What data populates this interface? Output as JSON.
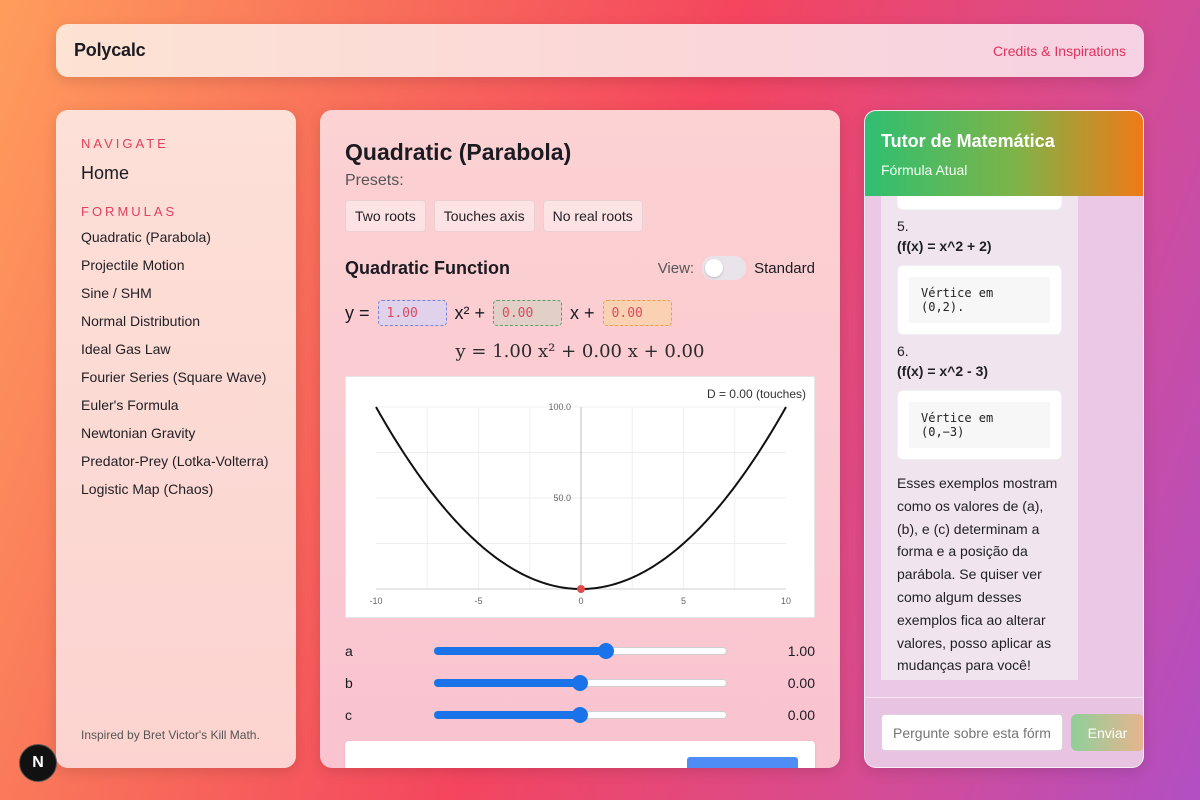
{
  "header": {
    "brand": "Polycalc",
    "credits_link": "Credits & Inspirations"
  },
  "sidebar": {
    "navigate_title": "NAVIGATE",
    "home": "Home",
    "formulas_title": "FORMULAS",
    "items": [
      "Quadratic (Parabola)",
      "Projectile Motion",
      "Sine / SHM",
      "Normal Distribution",
      "Ideal Gas Law",
      "Fourier Series (Square Wave)",
      "Euler's Formula",
      "Newtonian Gravity",
      "Predator-Prey (Lotka-Volterra)",
      "Logistic Map (Chaos)"
    ],
    "footer": "Inspired by Bret Victor's Kill Math."
  },
  "main": {
    "title": "Quadratic (Parabola)",
    "presets_label": "Presets:",
    "presets": [
      "Two roots",
      "Touches axis",
      "No real roots"
    ],
    "function_title": "Quadratic Function",
    "view_label": "View:",
    "view_value": "Standard",
    "eq_prefix": "y =",
    "eq_x2": "x² +",
    "eq_x": "x +",
    "coef_a": "1.00",
    "coef_b": "0.00",
    "coef_c": "0.00",
    "rendered_eq": "y = 1.00 x² + 0.00 x + 0.00",
    "sliders": [
      {
        "label": "a",
        "value": "1.00",
        "fraction": 0.59
      },
      {
        "label": "b",
        "value": "0.00",
        "fraction": 0.5
      },
      {
        "label": "c",
        "value": "0.00",
        "fraction": 0.5
      }
    ],
    "accent_color": "#1a73e8"
  },
  "chart_data": {
    "type": "line",
    "function": "y = 1.00x^2 + 0.00x + 0.00",
    "x": [
      -10,
      -9,
      -8,
      -7,
      -6,
      -5,
      -4,
      -3,
      -2,
      -1,
      0,
      1,
      2,
      3,
      4,
      5,
      6,
      7,
      8,
      9,
      10
    ],
    "y": [
      100,
      81,
      64,
      49,
      36,
      25,
      16,
      9,
      4,
      1,
      0,
      1,
      4,
      9,
      16,
      25,
      36,
      49,
      64,
      81,
      100
    ],
    "xlim": [
      -10,
      10
    ],
    "ylim": [
      0,
      100
    ],
    "x_ticks": [
      "-10",
      "-5",
      "0",
      "5",
      "10"
    ],
    "y_ticks": [
      "50.0",
      "100.0"
    ],
    "vertex": {
      "x": 0,
      "y": 0
    },
    "annotation": "D = 0.00 (touches)",
    "grid": true,
    "line_color": "#111111",
    "vertex_color": "#e24b4b"
  },
  "chat": {
    "title": "Tutor de Matemática",
    "subtitle": "Fórmula Atual",
    "examples": [
      {
        "num": "5.",
        "formula": "(f(x) = x^2 + 2)",
        "code": "Vértice em (0,2)."
      },
      {
        "num": "6.",
        "formula": "(f(x) = x^2 - 3)",
        "code": "Vértice em (0,−3)"
      }
    ],
    "paragraph": "Esses exemplos mostram como os valores de (a), (b), e (c) determinam a forma e a posição da parábola. Se quiser ver como algum desses exemplos fica ao alterar valores, posso aplicar as mudanças para você!",
    "input_placeholder": "Pergunte sobre esta fórmula...",
    "send_label": "Enviar"
  },
  "floating": {
    "badge": "N"
  }
}
